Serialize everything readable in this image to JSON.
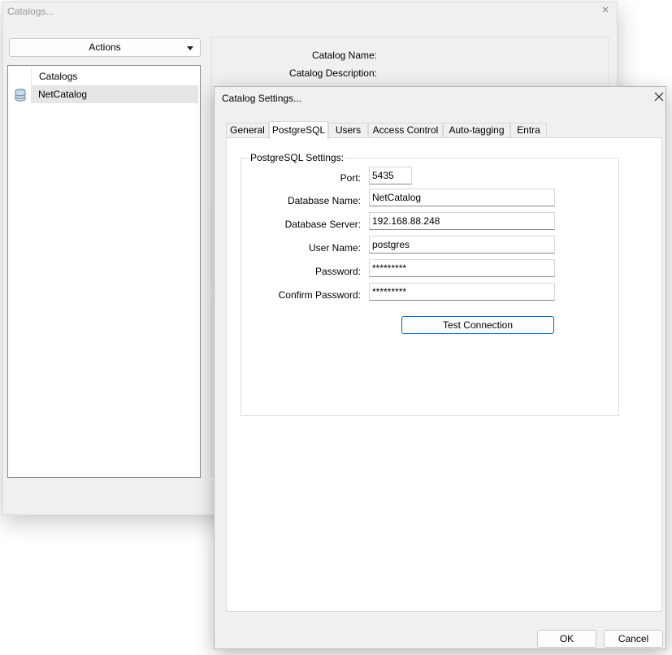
{
  "background_window": {
    "title": "Catalogs...",
    "close_glyph": "×",
    "actions_label": "Actions",
    "tree": {
      "header": "Catalogs",
      "items": [
        {
          "label": "NetCatalog",
          "icon": "database-icon"
        }
      ]
    },
    "labels": {
      "catalog_name": "Catalog Name:",
      "catalog_description": "Catalog Description:"
    }
  },
  "dialog": {
    "title": "Catalog Settings...",
    "tabs": [
      {
        "label": "General",
        "active": false
      },
      {
        "label": "PostgreSQL",
        "active": true
      },
      {
        "label": "Users",
        "active": false
      },
      {
        "label": "Access Control",
        "active": false
      },
      {
        "label": "Auto-tagging",
        "active": false
      },
      {
        "label": "Entra",
        "active": false
      }
    ],
    "group_title": "PostgreSQL Settings:",
    "fields": {
      "port": {
        "label": "Port:",
        "value": "5435"
      },
      "database_name": {
        "label": "Database Name:",
        "value": "NetCatalog"
      },
      "database_server": {
        "label": "Database Server:",
        "value": "192.168.88.248"
      },
      "user_name": {
        "label": "User Name:",
        "value": "postgres"
      },
      "password": {
        "label": "Password:",
        "value": "*********"
      },
      "confirm_password": {
        "label": "Confirm Password:",
        "value": "*********"
      }
    },
    "test_connection_label": "Test Connection",
    "ok_label": "OK",
    "cancel_label": "Cancel"
  },
  "colors": {
    "accent": "#0067c0",
    "window_bg": "#f0f0f0",
    "selection": "#e6e6e6"
  }
}
